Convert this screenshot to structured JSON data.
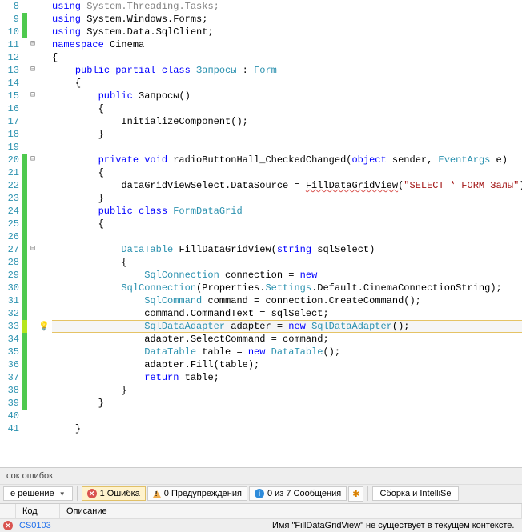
{
  "lines": [
    {
      "n": 8,
      "m": "",
      "f": "",
      "i": "",
      "html": "<span class='kw'>using</span> <span class='gray'>System.Threading.Tasks;</span>"
    },
    {
      "n": 9,
      "m": "green",
      "f": "",
      "i": "",
      "html": "<span class='kw'>using</span> <span class='txt'>System.Windows.Forms;</span>"
    },
    {
      "n": 10,
      "m": "green",
      "f": "",
      "i": "",
      "html": "<span class='kw'>using</span> <span class='txt'>System.Data.SqlClient;</span>"
    },
    {
      "n": 11,
      "m": "",
      "f": "⊟",
      "i": "",
      "html": "<span class='kw'>namespace</span> <span class='txt'>Cinema</span>"
    },
    {
      "n": 12,
      "m": "",
      "f": "",
      "i": "",
      "html": "<span class='txt'>{</span>"
    },
    {
      "n": 13,
      "m": "",
      "f": "⊟",
      "i": "",
      "html": "    <span class='kw'>public partial class</span> <span class='cls'>Запросы</span> <span class='txt'>:</span> <span class='cls'>Form</span>"
    },
    {
      "n": 14,
      "m": "",
      "f": "",
      "i": "",
      "html": "    <span class='txt'>{</span>"
    },
    {
      "n": 15,
      "m": "",
      "f": "⊟",
      "i": "",
      "html": "        <span class='kw'>public</span> <span class='txt'>Запросы()</span>"
    },
    {
      "n": 16,
      "m": "",
      "f": "",
      "i": "",
      "html": "        <span class='txt'>{</span>"
    },
    {
      "n": 17,
      "m": "",
      "f": "",
      "i": "",
      "html": "            <span class='txt'>InitializeComponent();</span>"
    },
    {
      "n": 18,
      "m": "",
      "f": "",
      "i": "",
      "html": "        <span class='txt'>}</span>"
    },
    {
      "n": 19,
      "m": "",
      "f": "",
      "i": "",
      "html": ""
    },
    {
      "n": 20,
      "m": "green",
      "f": "⊟",
      "i": "",
      "html": "        <span class='kw'>private void</span> <span class='txt'>radioButtonHall_CheckedChanged(</span><span class='kw'>object</span> <span class='txt'>sender,</span> <span class='cls'>EventArgs</span> <span class='txt'>e)</span>"
    },
    {
      "n": 21,
      "m": "green",
      "f": "",
      "i": "",
      "html": "        <span class='txt'>{</span>"
    },
    {
      "n": 22,
      "m": "green",
      "f": "",
      "i": "",
      "html": "            <span class='txt'>dataGridViewSelect.DataSource = </span><span class='wavy'>FillDataGridView</span><span class='txt'>(</span><span class='str'>\"SELECT * FORM Залы\"</span><span class='txt'>);</span>"
    },
    {
      "n": 23,
      "m": "green",
      "f": "",
      "i": "",
      "html": "        <span class='txt'>}</span>"
    },
    {
      "n": 24,
      "m": "green",
      "f": "",
      "i": "",
      "html": "        <span class='kw'>public class</span> <span class='cls'>FormDataGrid</span>"
    },
    {
      "n": 25,
      "m": "green",
      "f": "",
      "i": "",
      "html": "        <span class='txt'>{</span>"
    },
    {
      "n": 26,
      "m": "green",
      "f": "",
      "i": "",
      "html": ""
    },
    {
      "n": 27,
      "m": "green",
      "f": "⊟",
      "i": "",
      "html": "            <span class='cls'>DataTable</span> <span class='txt'>FillDataGridView(</span><span class='kw'>string</span> <span class='txt'>sqlSelect)</span>"
    },
    {
      "n": 28,
      "m": "green",
      "f": "",
      "i": "",
      "html": "            <span class='txt'>{</span>"
    },
    {
      "n": 29,
      "m": "green",
      "f": "",
      "i": "",
      "html": "                <span class='cls'>SqlConnection</span> <span class='txt'>connection =</span> <span class='kw'>new</span>"
    },
    {
      "n": 30,
      "m": "green",
      "f": "",
      "i": "",
      "html": "            <span class='cls'>SqlConnection</span><span class='txt'>(Properties.</span><span class='cls'>Settings</span><span class='txt'>.Default.CinemaConnectionString);</span>"
    },
    {
      "n": 31,
      "m": "green",
      "f": "",
      "i": "",
      "html": "                <span class='cls'>SqlCommand</span> <span class='txt'>command = connection.CreateCommand();</span>"
    },
    {
      "n": 32,
      "m": "green",
      "f": "",
      "i": "",
      "html": "                <span class='txt'>command.CommandText = sqlSelect;</span>"
    },
    {
      "n": 33,
      "m": "ygreen",
      "f": "",
      "i": "bulb",
      "hl": true,
      "html": "                <span class='cls'>SqlDataAdapter</span> <span class='txt'>adapter =</span> <span class='kw'>new</span> <span class='cls'>SqlDataAdapter</span><span class='txt'>();</span>"
    },
    {
      "n": 34,
      "m": "green",
      "f": "",
      "i": "",
      "html": "                <span class='txt'>adapter.SelectCommand = command;</span>"
    },
    {
      "n": 35,
      "m": "green",
      "f": "",
      "i": "",
      "html": "                <span class='cls'>DataTable</span> <span class='txt'>table =</span> <span class='kw'>new</span> <span class='cls'>DataTable</span><span class='txt'>();</span>"
    },
    {
      "n": 36,
      "m": "green",
      "f": "",
      "i": "",
      "html": "                <span class='txt'>adapter.Fill(table);</span>"
    },
    {
      "n": 37,
      "m": "green",
      "f": "",
      "i": "",
      "html": "                <span class='kw'>return</span> <span class='txt'>table;</span>"
    },
    {
      "n": 38,
      "m": "green",
      "f": "",
      "i": "",
      "html": "            <span class='txt'>}</span>"
    },
    {
      "n": 39,
      "m": "green",
      "f": "",
      "i": "",
      "html": "        <span class='txt'>}</span>"
    },
    {
      "n": 40,
      "m": "",
      "f": "",
      "i": "",
      "html": ""
    },
    {
      "n": 41,
      "m": "",
      "f": "",
      "i": "",
      "html": "    <span class='txt'>}</span>"
    }
  ],
  "errlist": {
    "title": "сок ошибок",
    "filter": "е решение",
    "btn_err": "1 Ошибка",
    "btn_warn": "0 Предупреждения",
    "btn_msg": "0 из 7 Сообщения",
    "right": "Сборка и IntelliSe",
    "hdr_code": "Код",
    "hdr_desc": "Описание",
    "row": {
      "code": "CS0103",
      "desc": "Имя \"FillDataGridView\" не существует в текущем контексте."
    }
  }
}
